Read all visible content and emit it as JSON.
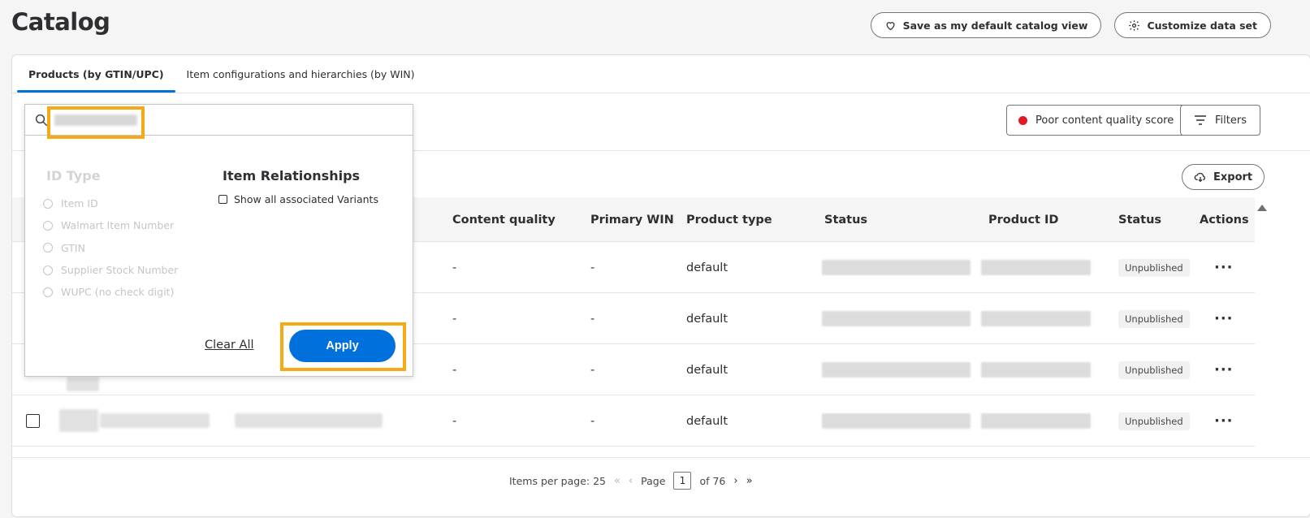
{
  "page": {
    "title": "Catalog"
  },
  "top_actions": {
    "save_default": "Save as my default catalog view",
    "customize": "Customize data set"
  },
  "tabs": [
    {
      "label": "Products (by GTIN/UPC)",
      "active": true
    },
    {
      "label": "Item configurations and hierarchies (by WIN)",
      "active": false
    }
  ],
  "toolbar": {
    "quality_label": "Poor content quality score",
    "filters_label": "Filters",
    "export_label": "Export"
  },
  "search": {
    "value": "",
    "id_type_title": "ID Type",
    "id_types": [
      "Item ID",
      "Walmart Item Number",
      "GTIN",
      "Supplier Stock Number",
      "WUPC (no check digit)"
    ],
    "relationships_title": "Item Relationships",
    "relationships_option": "Show all associated Variants",
    "clear_label": "Clear All",
    "apply_label": "Apply"
  },
  "table": {
    "columns": [
      "Content quality",
      "Primary WIN",
      "Product type",
      "Status",
      "Product ID",
      "Status",
      "Actions"
    ],
    "rows": [
      {
        "content_quality": "-",
        "primary_win": "-",
        "product_type": "default",
        "status": "Unpublished"
      },
      {
        "content_quality": "-",
        "primary_win": "-",
        "product_type": "default",
        "status": "Unpublished"
      },
      {
        "content_quality": "-",
        "primary_win": "-",
        "product_type": "default",
        "status": "Unpublished"
      },
      {
        "content_quality": "-",
        "primary_win": "-",
        "product_type": "default",
        "status": "Unpublished"
      }
    ],
    "actions_glyph": "···"
  },
  "pagination": {
    "items_per_page": "Items per page: 25",
    "page_label": "Page",
    "current_page": "1",
    "total": "of 76"
  },
  "colors": {
    "accent": "#0071dc",
    "highlight": "#f4a915",
    "quality_dot": "#de1c24"
  }
}
